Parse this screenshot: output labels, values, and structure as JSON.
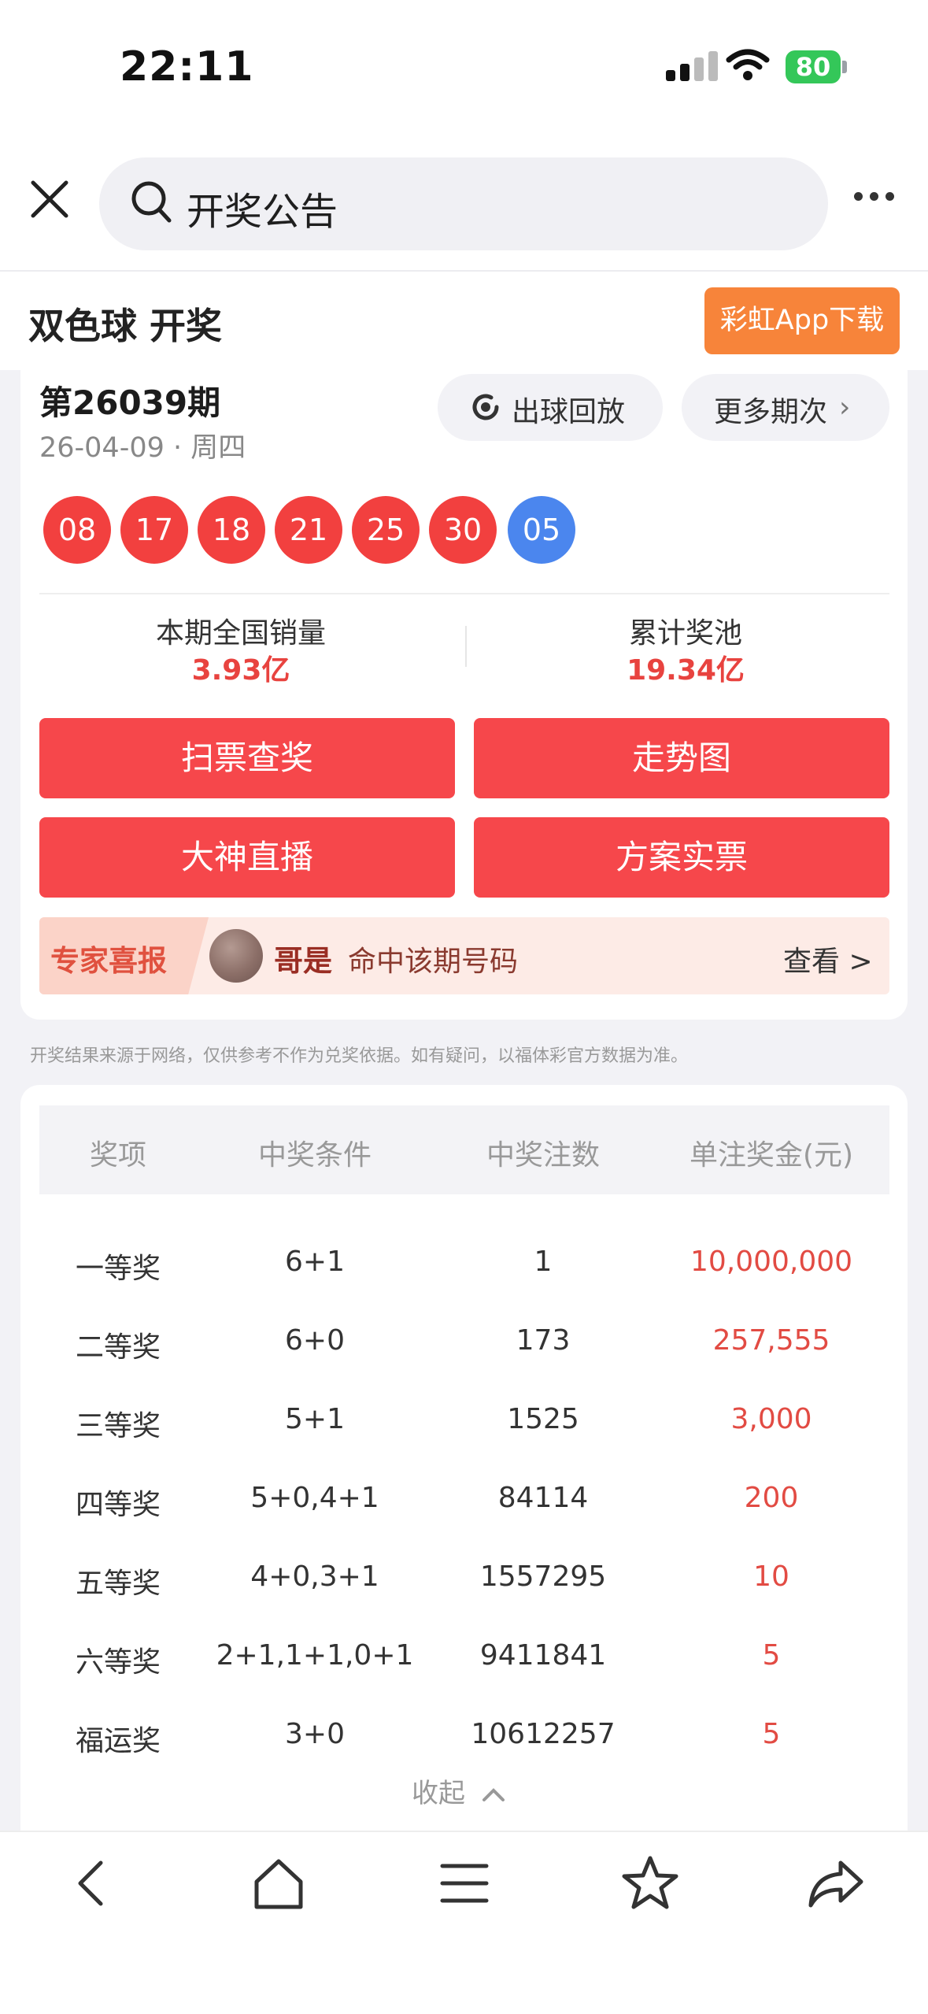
{
  "status_bar": {
    "time": "22:11",
    "battery": "80"
  },
  "search": {
    "query": "开奖公告"
  },
  "header": {
    "title": "双色球 开奖",
    "download_button": "彩虹App下载"
  },
  "draw": {
    "issue": "第26039期",
    "date": "26-04-09 · 周四",
    "replay_button": "出球回放",
    "more_issues_button": "更多期次",
    "red_balls": [
      "08",
      "17",
      "18",
      "21",
      "25",
      "30"
    ],
    "blue_ball": "05",
    "sales_label": "本期全国销量",
    "sales_value": "3.93亿",
    "pool_label": "累计奖池",
    "pool_value": "19.34亿"
  },
  "actions": {
    "scan": "扫票查奖",
    "trend": "走势图",
    "live": "大神直播",
    "plan": "方案实票"
  },
  "expert": {
    "tag": "专家喜报",
    "name": "哥是",
    "text": "命中该期号码",
    "view": "查看 >"
  },
  "disclaimer": "开奖结果来源于网络，仅供参考不作为兑奖依据。如有疑问，以福体彩官方数据为准。",
  "prize_table": {
    "headers": [
      "奖项",
      "中奖条件",
      "中奖注数",
      "单注奖金(元)"
    ],
    "rows": [
      {
        "prize": "一等奖",
        "condition": "6+1",
        "count": "1",
        "amount": "10,000,000"
      },
      {
        "prize": "二等奖",
        "condition": "6+0",
        "count": "173",
        "amount": "257,555"
      },
      {
        "prize": "三等奖",
        "condition": "5+1",
        "count": "1525",
        "amount": "3,000"
      },
      {
        "prize": "四等奖",
        "condition": "5+0,4+1",
        "count": "84114",
        "amount": "200"
      },
      {
        "prize": "五等奖",
        "condition": "4+0,3+1",
        "count": "1557295",
        "amount": "10"
      },
      {
        "prize": "六等奖",
        "condition": "2+1,1+1,0+1",
        "count": "9411841",
        "amount": "5"
      },
      {
        "prize": "福运奖",
        "condition": "3+0",
        "count": "10612257",
        "amount": "5"
      }
    ],
    "collapse_label": "收起"
  },
  "colors": {
    "red": "#f2403f",
    "blue": "#4b86ee",
    "button_red": "#f6474b",
    "orange": "#f7843a"
  },
  "bottom_nav": {
    "icons": [
      "back-icon",
      "home-icon",
      "menu-icon",
      "star-icon",
      "share-icon"
    ]
  }
}
